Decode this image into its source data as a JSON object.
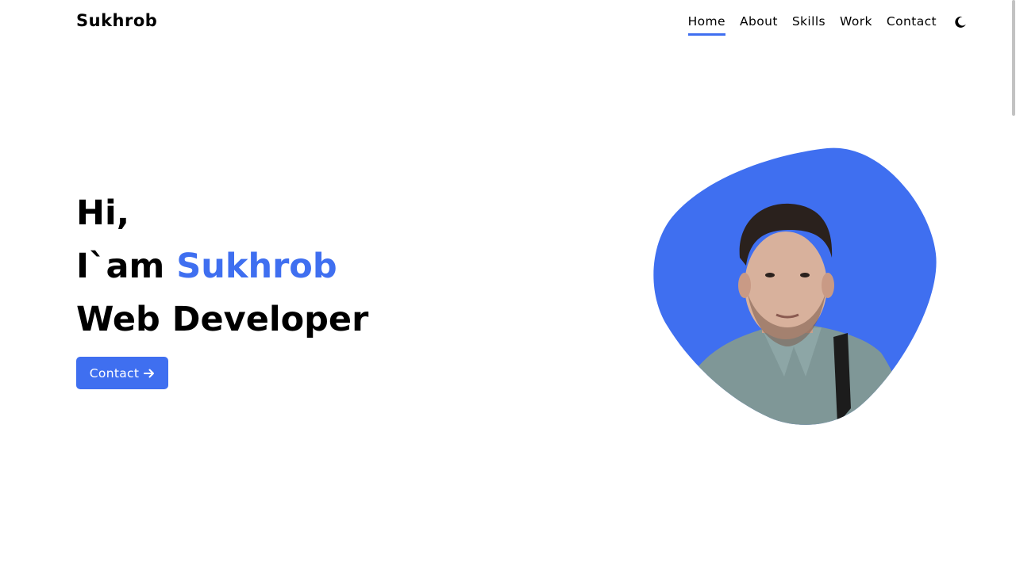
{
  "brand": {
    "name": "Sukhrob",
    "accent_color": "#3f6ff0"
  },
  "nav": {
    "items": [
      {
        "label": "Home",
        "active": true
      },
      {
        "label": "About",
        "active": false
      },
      {
        "label": "Skills",
        "active": false
      },
      {
        "label": "Work",
        "active": false
      },
      {
        "label": "Contact",
        "active": false
      }
    ],
    "theme_toggle_icon": "moon-icon"
  },
  "hero": {
    "greeting": "Hi,",
    "intro_prefix": "I`am ",
    "name": "Sukhrob",
    "role": "Web Developer",
    "cta_label": "Contact",
    "cta_icon": "arrow-right-icon",
    "image_icon": "profile-photo"
  }
}
